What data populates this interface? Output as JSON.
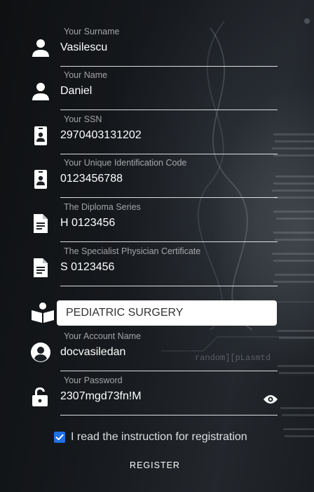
{
  "form": {
    "fields": [
      {
        "label": "Your Surname",
        "value": "Vasilescu",
        "icon": "person-icon"
      },
      {
        "label": "Your Name",
        "value": "Daniel",
        "icon": "person-icon"
      },
      {
        "label": "Your SSN",
        "value": "2970403131202",
        "icon": "badge-icon"
      },
      {
        "label": "Your Unique Identification Code",
        "value": "0123456788",
        "icon": "badge-icon"
      },
      {
        "label": "The Diploma Series",
        "value": "H 0123456",
        "icon": "document-icon"
      },
      {
        "label": "The Specialist Physician Certificate",
        "value": "S 0123456",
        "icon": "document-icon"
      }
    ],
    "specialty": {
      "value": "PEDIATRIC SURGERY",
      "icon": "book-reader-icon"
    },
    "account": {
      "label": "Your Account Name",
      "value": "docvasiledan",
      "icon": "account-circle-icon"
    },
    "password": {
      "label": "Your Password",
      "value": "2307mgd73fn!M",
      "icon": "lock-open-icon"
    },
    "checkbox": {
      "label": "I read the instruction for registration",
      "checked": true
    },
    "submit_label": "REGISTER"
  },
  "background": {
    "code_text": "random][pLasmtd"
  },
  "colors": {
    "checkbox": "#1f6fe5",
    "icon": "#ffffff"
  }
}
